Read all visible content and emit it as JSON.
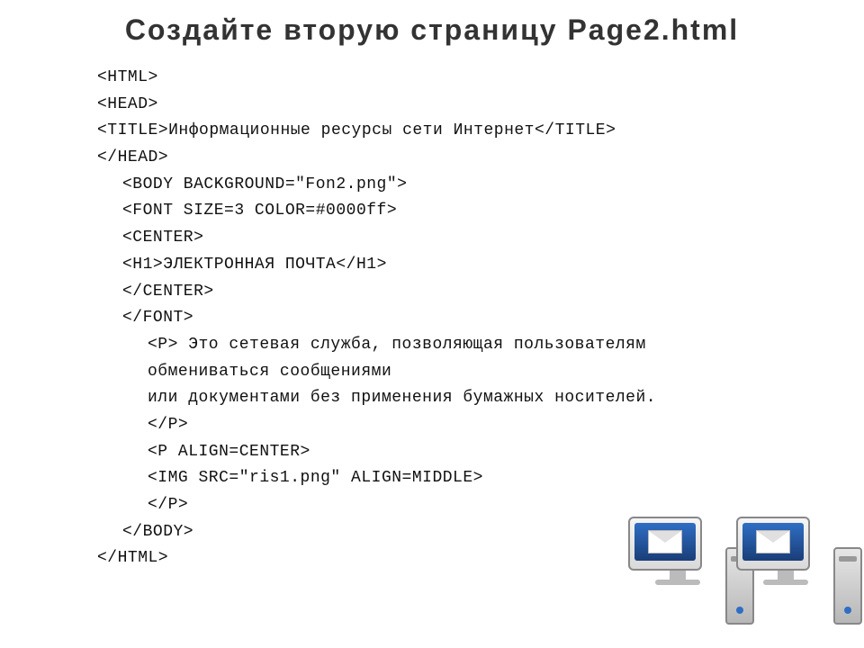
{
  "heading": "Создайте вторую страницу Page2.html",
  "code": {
    "l01": "<HTML>",
    "l02": "<HEAD>",
    "l03a": "<TITLE>",
    "l03b": "Информационные ресурсы сети Интернет",
    "l03c": "</TITLE>",
    "l04": "</HEAD>",
    "l05": "<BODY BACKGROUND=\"Fon2.png\">",
    "l06": "<FONT SIZE=3 COLOR=#0000ff>",
    "l07": "<CENTER>",
    "l08a": "<H1>",
    "l08b": "ЭЛЕКТРОННАЯ ПОЧТА",
    "l08c": "</H1>",
    "l09": "</CENTER>",
    "l10": "</FONT>",
    "l11": "<P> Это сетевая служба, позволяющая пользователям",
    "l12": "обмениваться сообщениями",
    "l13": "или документами без применения бумажных носителей.",
    "l14": "</P>",
    "l15": "<P ALIGN=CENTER>",
    "l16": "<IMG SRC=\"ris1.png\" ALIGN=MIDDLE>",
    "l17": "</P>",
    "l18": "</BODY>",
    "l19": "</HTML>"
  }
}
